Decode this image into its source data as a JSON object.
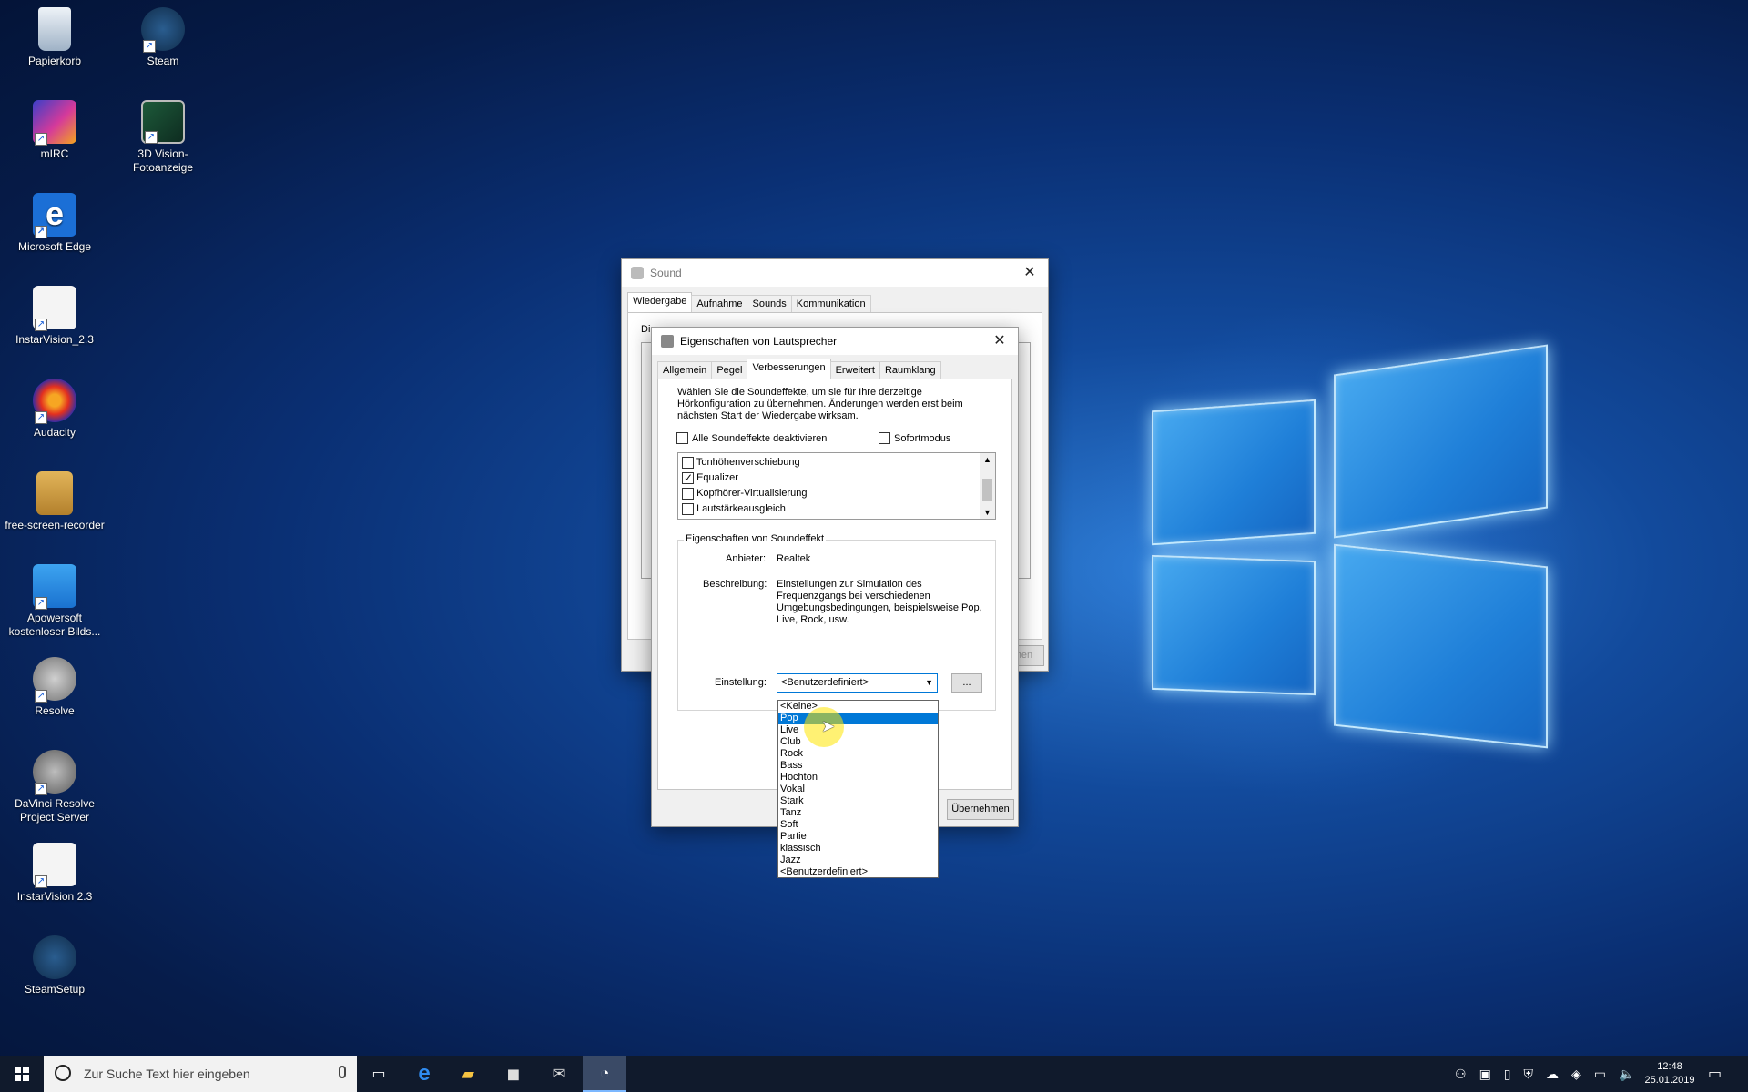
{
  "desktop": {
    "icons": [
      {
        "label": "Papierkorb"
      },
      {
        "label": "Steam"
      },
      {
        "label": "mIRC"
      },
      {
        "label": "3D Vision-Fotoanzeige"
      },
      {
        "label": "Microsoft Edge"
      },
      {
        "label": "InstarVision_2.3"
      },
      {
        "label": "Audacity"
      },
      {
        "label": "free-screen-recorder"
      },
      {
        "label": "Apowersoft kostenloser Bilds..."
      },
      {
        "label": "Resolve"
      },
      {
        "label": "DaVinci Resolve Project Server"
      },
      {
        "label": "InstarVision 2.3"
      },
      {
        "label": "SteamSetup"
      }
    ]
  },
  "sound_window": {
    "title": "Sound",
    "tabs": [
      "Wiedergabe",
      "Aufnahme",
      "Sounds",
      "Kommunikation"
    ],
    "active_tab": "Wiedergabe",
    "partial_text": "Di",
    "partial_button": "nen"
  },
  "speaker_dialog": {
    "title": "Eigenschaften von Lautsprecher",
    "tabs": [
      "Allgemein",
      "Pegel",
      "Verbesserungen",
      "Erweitert",
      "Raumklang"
    ],
    "active_tab": "Verbesserungen",
    "intro_text": "Wählen Sie die Soundeffekte, um sie für Ihre derzeitige Hörkonfiguration zu übernehmen. Änderungen werden erst beim nächsten Start der Wiedergabe wirksam.",
    "disable_all_label": "Alle Soundeffekte deaktivieren",
    "disable_all_checked": false,
    "immediate_mode_label": "Sofortmodus",
    "immediate_mode_checked": false,
    "effects": [
      {
        "label": "Tonhöhenverschiebung",
        "checked": false
      },
      {
        "label": "Equalizer",
        "checked": true
      },
      {
        "label": "Kopfhörer-Virtualisierung",
        "checked": false
      },
      {
        "label": "Lautstärkeausgleich",
        "checked": false
      }
    ],
    "properties_group_label": "Eigenschaften von Soundeffekt",
    "provider_label": "Anbieter:",
    "provider_value": "Realtek",
    "description_label": "Beschreibung:",
    "description_value": "Einstellungen zur Simulation des Frequenzgangs bei verschiedenen Umgebungsbedingungen, beispielsweise Pop, Live, Rock, usw.",
    "setting_label": "Einstellung:",
    "setting_value": "<Benutzerdefiniert>",
    "more_button": "...",
    "apply_button": "Übernehmen",
    "dropdown_options": [
      "<Keine>",
      "Pop",
      "Live",
      "Club",
      "Rock",
      "Bass",
      "Hochton",
      "Vokal",
      "Stark",
      "Tanz",
      "Soft",
      "Partie",
      "klassisch",
      "Jazz",
      "<Benutzerdefiniert>"
    ],
    "highlighted_option": "Pop"
  },
  "taskbar": {
    "search_placeholder": "Zur Suche Text hier eingeben",
    "time": "12:48",
    "date": "25.01.2019"
  }
}
